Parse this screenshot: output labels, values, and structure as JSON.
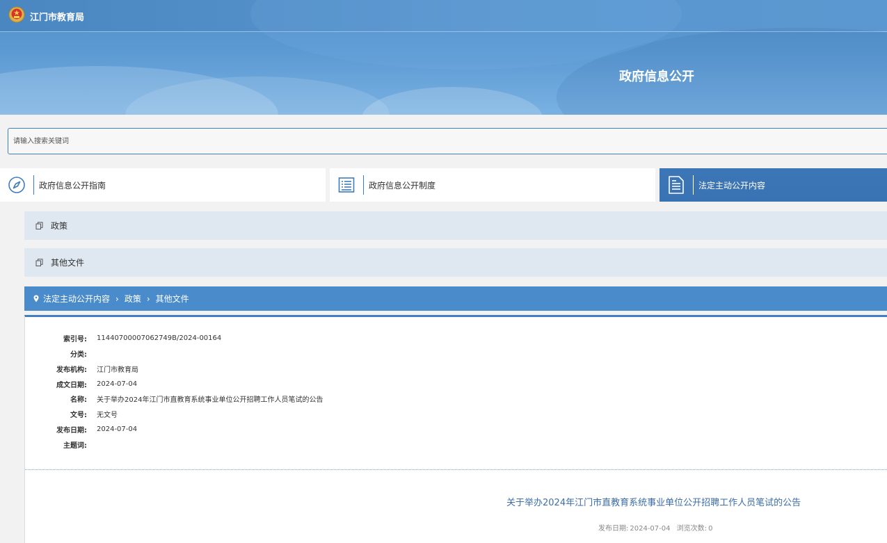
{
  "header": {
    "site_name": "江门市教育局",
    "page_heading": "政府信息公开"
  },
  "search": {
    "placeholder": "请输入搜索关键词"
  },
  "nav_tabs": [
    {
      "label": "政府信息公开指南",
      "icon": "compass-icon",
      "active": false
    },
    {
      "label": "政府信息公开制度",
      "icon": "list-icon",
      "active": false
    },
    {
      "label": "法定主动公开内容",
      "icon": "document-icon",
      "active": true
    }
  ],
  "categories": [
    {
      "label": "政策",
      "icon": "copy-icon"
    },
    {
      "label": "其他文件",
      "icon": "copy-icon"
    }
  ],
  "breadcrumb": {
    "items": [
      "法定主动公开内容",
      "政策",
      "其他文件"
    ]
  },
  "meta": [
    {
      "key": "索引号:",
      "value": "11440700007062749B/2024-00164"
    },
    {
      "key": "分类:",
      "value": ""
    },
    {
      "key": "发布机构:",
      "value": "江门市教育局"
    },
    {
      "key": "成文日期:",
      "value": "2024-07-04"
    },
    {
      "key": "名称:",
      "value": "关于举办2024年江门市直教育系统事业单位公开招聘工作人员笔试的公告"
    },
    {
      "key": "文号:",
      "value": "无文号"
    },
    {
      "key": "发布日期:",
      "value": "2024-07-04"
    },
    {
      "key": "主题词:",
      "value": ""
    }
  ],
  "document": {
    "title": "关于举办2024年江门市直教育系统事业单位公开招聘工作人员笔试的公告",
    "publish_label": "发布日期:",
    "publish_date": "2024-07-04",
    "views_label": "浏览次数:",
    "views": "0"
  },
  "colors": {
    "accent": "#3a73b3",
    "banner": "#5c9ad3",
    "category_bg": "#dfe8f1",
    "breadcrumb_bg": "#4a8ccb"
  }
}
